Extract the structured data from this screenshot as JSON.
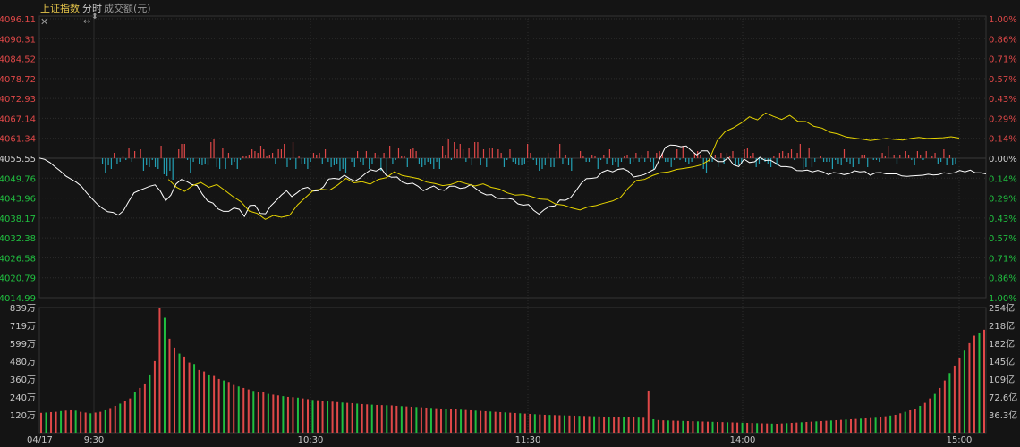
{
  "header": {
    "title": "上证指数",
    "mode": "分时",
    "amount_label": "成交额(元)"
  },
  "icons": {
    "close": "close-icon",
    "move": "resize-horizontal-icon",
    "pin": "crosshair-marker-icon"
  },
  "colors": {
    "up": "#e04848",
    "down": "#20c040",
    "flat": "#cfcfcf",
    "flow_down": "#23a0b4",
    "index_line": "#ffffff",
    "avg_line": "#e6d400",
    "background": "#141414",
    "grid": "#2c2c2c"
  },
  "chart_data": [
    {
      "type": "line",
      "title": "上证指数",
      "subtitle": "分时",
      "y_left_ticks": [
        "4096.11",
        "4090.31",
        "4084.52",
        "4078.72",
        "4072.93",
        "4067.14",
        "4061.34",
        "4055.55",
        "4049.76",
        "4043.96",
        "4038.17",
        "4032.38",
        "4026.58",
        "4020.79",
        "4014.99"
      ],
      "y_right_ticks": [
        "1.00%",
        "0.86%",
        "0.71%",
        "0.57%",
        "0.43%",
        "0.29%",
        "0.14%",
        "0.00%",
        "0.14%",
        "0.29%",
        "0.43%",
        "0.57%",
        "0.71%",
        "0.86%",
        "1.00%"
      ],
      "ylim": [
        4014.99,
        4096.11
      ],
      "prev_close": 4055.55,
      "x_ticks": [
        "04/17",
        "9:30",
        "10:30",
        "11:30",
        "14:00",
        "15:00"
      ],
      "series": [
        {
          "name": "index",
          "values": [
            4055.6,
            4055.2,
            4054.3,
            4053.0,
            4051.8,
            4050.4,
            4049.5,
            4048.6,
            4047.4,
            4045.5,
            4043.8,
            4042.2,
            4041.0,
            4040.0,
            4039.8,
            4039.0,
            4040.3,
            4043.0,
            4045.5,
            4046.2,
            4046.8,
            4047.4,
            4047.8,
            4046.0,
            4043.2,
            4044.8,
            4048.1,
            4049.4,
            4048.8,
            4047.9,
            4047.6,
            4045.1,
            4043.1,
            4042.5,
            4040.8,
            4040.1,
            4040.1,
            4041.1,
            4040.7,
            4038.6,
            4041.8,
            4041.9,
            4039.5,
            4039.4,
            4041.7,
            4043.2,
            4044.8,
            4046.1,
            4044.4,
            4045.5,
            4046.7,
            4047.1,
            4046.0,
            4046.1,
            4047.2,
            4049.5,
            4049.7,
            4049.5,
            4050.6,
            4049.6,
            4048.9,
            4049.8,
            4051.1,
            4052.2,
            4051.8,
            4052.6,
            4050.5,
            4050.0,
            4050.1,
            4048.6,
            4048.1,
            4048.3,
            4047.4,
            4046.1,
            4046.9,
            4047.5,
            4046.5,
            4046.2,
            4047.4,
            4047.4,
            4046.8,
            4047.0,
            4047.9,
            4046.7,
            4045.6,
            4044.9,
            4045.0,
            4043.9,
            4043.8,
            4043.9,
            4043.6,
            4042.3,
            4041.9,
            4042.1,
            4040.4,
            4039.3,
            4040.6,
            4041.5,
            4041.7,
            4043.4,
            4043.3,
            4044.1,
            4046.0,
            4048.2,
            4049.6,
            4049.7,
            4049.9,
            4051.5,
            4052.1,
            4051.6,
            4052.3,
            4052.5,
            4051.8,
            4050.1,
            4050.4,
            4050.8,
            4051.6,
            4052.4,
            4055.5,
            4058.7,
            4059.4,
            4059.3,
            4058.9,
            4059.1,
            4057.7,
            4056.5,
            4057.7,
            4057.7,
            4055.6,
            4054.6,
            4054.6,
            4055.7,
            4053.6,
            4053.1,
            4055.3,
            4054.3,
            4054.5,
            4055.8,
            4054.9,
            4055.0,
            4054.1,
            4053.1,
            4053.1,
            4052.9,
            4052.0,
            4051.9,
            4052.1,
            4051.6,
            4052.0,
            4051.6,
            4050.8,
            4051.4,
            4051.2,
            4050.8,
            4051.1,
            4051.9,
            4051.6,
            4051.7,
            4050.6,
            4051.3,
            4051.4,
            4051.0,
            4051.0,
            4051.0,
            4050.4,
            4050.3,
            4050.4,
            4050.5,
            4050.6,
            4050.9,
            4050.7,
            4050.8,
            4051.3,
            4051.1,
            4051.3,
            4052.0,
            4051.6,
            4052.1,
            4051.3,
            4051.3,
            4051.0
          ],
          "color": "#ffffff"
        },
        {
          "name": "average",
          "values": [
            null,
            null,
            null,
            null,
            null,
            null,
            null,
            null,
            null,
            null,
            null,
            null,
            null,
            null,
            null,
            null,
            4049.4,
            4047.1,
            4045.9,
            4047.6,
            4048.5,
            4047.1,
            4047.9,
            4046.2,
            4044.4,
            4042.9,
            4040.2,
            4039.5,
            4037.8,
            4038.9,
            4038.4,
            4038.9,
            4042.0,
            4044.2,
            4046.3,
            4046.5,
            4046.3,
            4047.8,
            4049.7,
            4048.4,
            4048.7,
            4048.0,
            4049.4,
            4049.9,
            4051.6,
            4050.5,
            4050.1,
            4049.6,
            4048.6,
            4048.2,
            4047.6,
            4047.9,
            4048.8,
            4048.1,
            4047.5,
            4048.1,
            4047.1,
            4046.6,
            4045.5,
            4044.8,
            4045.0,
            4044.4,
            4043.7,
            4043.5,
            4042.2,
            4041.9,
            4041.1,
            4040.5,
            4041.4,
            4041.8,
            4042.5,
            4043.1,
            4044.1,
            4046.9,
            4049.1,
            4049.4,
            4050.5,
            4051.3,
            4051.6,
            4052.3,
            4052.6,
            4053.0,
            4053.6,
            4055.0,
            4060.6,
            4063.3,
            4064.4,
            4065.8,
            4067.6,
            4066.7,
            4068.7,
            4067.7,
            4066.8,
            4068.0,
            4066.3,
            4066.2,
            4064.8,
            4064.3,
            4063.1,
            4062.6,
            4061.7,
            4061.4,
            4061.1,
            4060.7,
            4061.0,
            4061.3,
            4061.0,
            4060.8,
            4061.3,
            4061.6,
            4061.3,
            4061.4,
            4061.5,
            4061.8,
            4061.4
          ],
          "color": "#e6d400"
        }
      ],
      "flow_bars": [
        0,
        0,
        -3,
        -8,
        -4,
        -6,
        3,
        -3,
        -2,
        1,
        -1,
        6,
        -2,
        4,
        0,
        5,
        -7,
        -4,
        -5,
        -1,
        -5,
        -6,
        7,
        -9,
        -10,
        -7,
        -12,
        0,
        5,
        8,
        8,
        -1,
        -8,
        -2,
        0,
        -3,
        -4,
        -3,
        -4,
        9,
        11,
        -5,
        -6,
        6,
        -6,
        3,
        -4,
        -2,
        -6,
        -1,
        1,
        1,
        2,
        5,
        4,
        3,
        7,
        5,
        1,
        2,
        3,
        -3,
        5,
        5,
        8,
        -5,
        -1,
        9,
        -6,
        1,
        -3,
        -3,
        -6,
        -2,
        3,
        2,
        3,
        -3,
        5,
        -2,
        -5,
        -4,
        -3,
        -7,
        -6,
        -8,
        0,
        -2,
        -5,
        4,
        -2,
        -4,
        4,
        -6,
        -3,
        3,
        2,
        -7,
        3,
        -8,
        7,
        -3,
        -1,
        6,
        1,
        1,
        -5,
        5,
        6,
        4,
        -3,
        -5,
        -4,
        -2,
        -3,
        -6,
        -2,
        -6,
        7,
        2,
        11,
        -1,
        9,
        5,
        8,
        5,
        -2,
        6,
        -4,
        9,
        9,
        -4,
        5,
        -5,
        6,
        6,
        0,
        5,
        3,
        -5,
        -1,
        5,
        -2,
        -3,
        -4,
        -4,
        -3,
        8,
        3,
        -1,
        -4,
        -7,
        -6,
        -4,
        3,
        -5,
        -5,
        4,
        8,
        -3,
        2,
        -4,
        -7,
        0,
        0,
        4,
        1,
        -2,
        -2,
        2,
        1,
        -6,
        -1,
        2,
        -3,
        5,
        -4,
        -2,
        -5,
        -2,
        1,
        2,
        -3,
        -2,
        3,
        -2,
        2,
        -2,
        4,
        -2,
        -6,
        3,
        4,
        3,
        -2,
        -2,
        -5,
        -1,
        5,
        -1,
        7,
        -2,
        -3,
        -2,
        3,
        4,
        2,
        -6,
        -8,
        -2,
        -2,
        2,
        -5,
        3,
        -3,
        3,
        1,
        4,
        -4,
        -4,
        -3,
        5,
        6,
        1,
        3,
        -5,
        -3,
        -1,
        -2,
        -3,
        -5,
        1,
        -4,
        3,
        4,
        1,
        3,
        5,
        -1,
        3,
        8,
        -6,
        -5,
        6,
        -5,
        -2,
        0,
        1,
        -2,
        -2,
        -2,
        -6,
        -1,
        -3,
        -4,
        5,
        -2,
        -3,
        -5,
        0,
        -3,
        2,
        2,
        -5,
        0,
        -1,
        -1,
        -2,
        3,
        1,
        7,
        0,
        2,
        -3,
        2,
        0,
        4,
        2,
        -1,
        -4,
        4,
        2,
        -1,
        4,
        0,
        1,
        3,
        -3,
        -2,
        5,
        -4,
        2,
        -4,
        -3
      ]
    },
    {
      "type": "bar",
      "title": "成交额(元)",
      "y_left_ticks": [
        "839万",
        "719万",
        "599万",
        "480万",
        "360万",
        "240万",
        "120万"
      ],
      "y_right_ticks": [
        "254亿",
        "218亿",
        "182亿",
        "145亿",
        "109亿",
        "72.6亿",
        "36.3亿"
      ],
      "ylim": [
        0,
        8390000
      ],
      "x_ticks": [
        "04/17",
        "9:30",
        "10:30",
        "11:30",
        "14:00",
        "15:00"
      ],
      "series": [
        {
          "name": "volume",
          "values": [
            1330000,
            1350000,
            1380000,
            1400000,
            1450000,
            1480000,
            1500000,
            1480000,
            1400000,
            1350000,
            1300000,
            1350000,
            1400000,
            1500000,
            1650000,
            1800000,
            1950000,
            2100000,
            2300000,
            2700000,
            3000000,
            3300000,
            3900000,
            4800000,
            8390000,
            7700000,
            6300000,
            5700000,
            5300000,
            5100000,
            4700000,
            4600000,
            4200000,
            4100000,
            3900000,
            3800000,
            3600000,
            3500000,
            3400000,
            3200000,
            3100000,
            3000000,
            2900000,
            2800000,
            2700000,
            2750000,
            2600000,
            2550000,
            2500000,
            2450000,
            2400000,
            2380000,
            2350000,
            2300000,
            2250000,
            2200000,
            2180000,
            2150000,
            2100000,
            2080000,
            2050000,
            2020000,
            2000000,
            1980000,
            1950000,
            1920000,
            1900000,
            1880000,
            1860000,
            1850000,
            1840000,
            1830000,
            1800000,
            1780000,
            1760000,
            1740000,
            1720000,
            1700000,
            1680000,
            1660000,
            1640000,
            1620000,
            1600000,
            1580000,
            1560000,
            1540000,
            1520000,
            1500000,
            1480000,
            1460000,
            1440000,
            1420000,
            1400000,
            1380000,
            1360000,
            1340000,
            1320000,
            1300000,
            1280000,
            1260000,
            1240000,
            1220000,
            1200000,
            1190000,
            1180000,
            1170000,
            1160000,
            1150000,
            1140000,
            1130000,
            1120000,
            1110000,
            1100000,
            1090000,
            1080000,
            1070000,
            1060000,
            1050000,
            1040000,
            1030000,
            1020000,
            1010000,
            1000000,
            2820000,
            900000,
            850000,
            830000,
            820000,
            810000,
            800000,
            790000,
            780000,
            770000,
            760000,
            750000,
            740000,
            730000,
            720000,
            710000,
            700000,
            690000,
            680000,
            670000,
            660000,
            650000,
            640000,
            630000,
            620000,
            610000,
            600000,
            620000,
            640000,
            660000,
            680000,
            700000,
            720000,
            740000,
            760000,
            780000,
            800000,
            820000,
            840000,
            860000,
            880000,
            900000,
            920000,
            940000,
            960000,
            980000,
            1000000,
            1050000,
            1100000,
            1150000,
            1200000,
            1300000,
            1400000,
            1500000,
            1600000,
            1800000,
            2000000,
            2300000,
            2600000,
            3000000,
            3500000,
            4000000,
            4500000,
            5000000,
            5500000,
            6000000,
            6500000,
            6700000,
            6900000
          ],
          "colors_pattern": "alternating-red-green"
        }
      ]
    }
  ]
}
